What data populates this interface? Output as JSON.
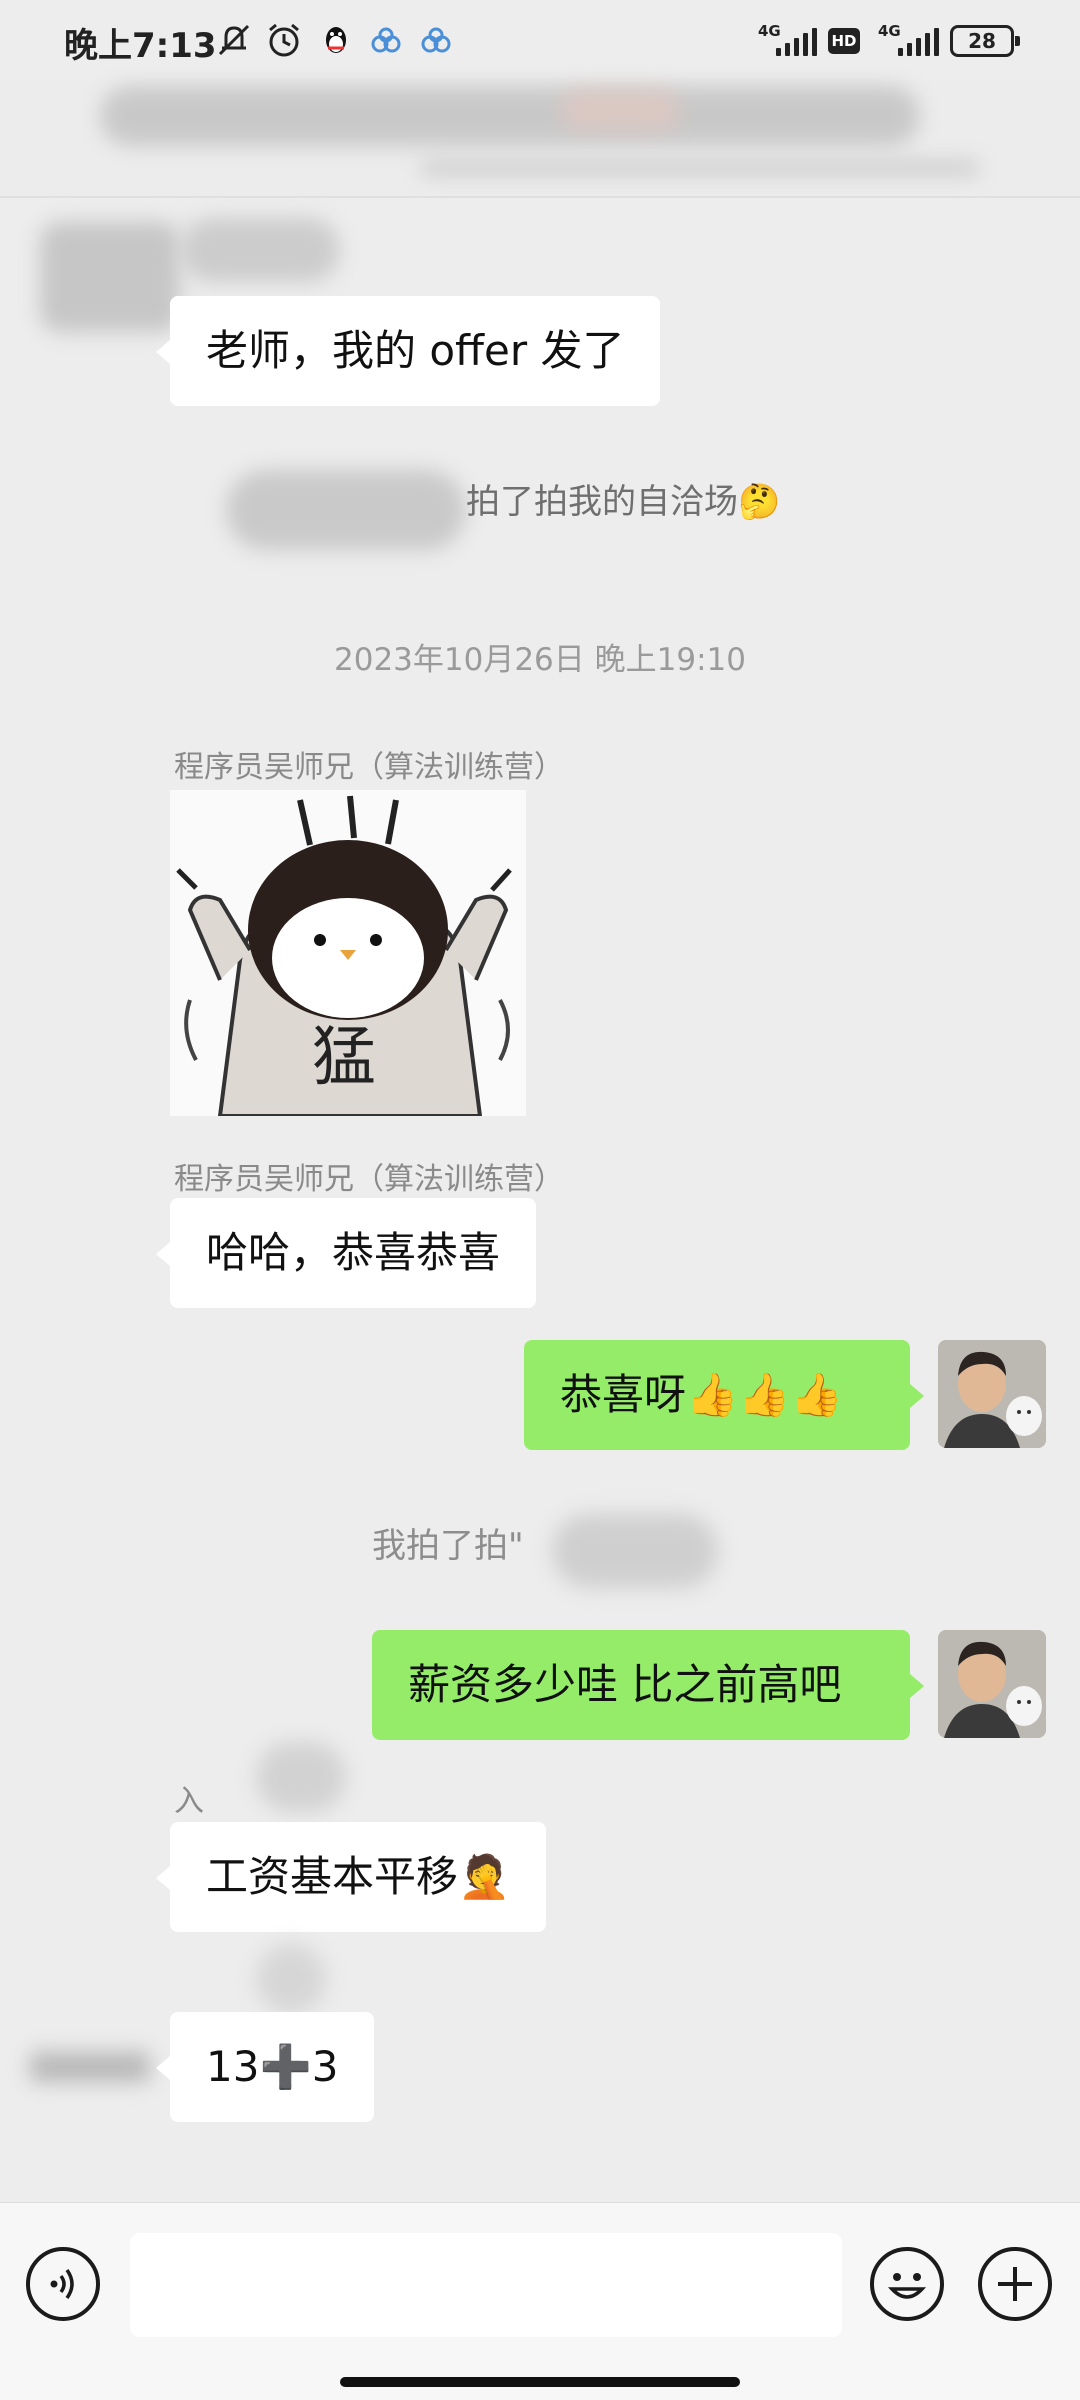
{
  "status_bar": {
    "time": "晚上7:13",
    "signal1_label": "4G",
    "hd_label": "HD",
    "signal2_label": "4G",
    "battery": "28",
    "icons": [
      "mute-icon",
      "alarm-icon",
      "qq-icon",
      "cloud-icon",
      "cloud-icon"
    ]
  },
  "messages": {
    "m1_text": "老师，我的 offer 发了",
    "pat1_text": "拍了拍我的自洽场🤔",
    "timestamp": "2023年10月26日 晚上19:10",
    "sender_name_1": "程序员吴师兄（算法训练营）",
    "sticker_char": "猛",
    "sender_name_2": "程序员吴师兄（算法训练营）",
    "m2_text": "哈哈，恭喜恭喜",
    "m3_text": "恭喜呀👍👍👍",
    "pat2_text": "我拍了拍\"",
    "m4_text": "薪资多少哇 比之前高吧",
    "sender_name_3": "入",
    "m5_text": "工资基本平移🤦",
    "m6_text": "13➕3"
  },
  "colors": {
    "background": "#ededed",
    "bubble_self": "#95ec69",
    "bubble_other": "#ffffff"
  },
  "input_bar": {
    "voice_icon": "voice-icon",
    "emoji_icon": "emoji-icon",
    "plus_icon": "plus-icon"
  }
}
